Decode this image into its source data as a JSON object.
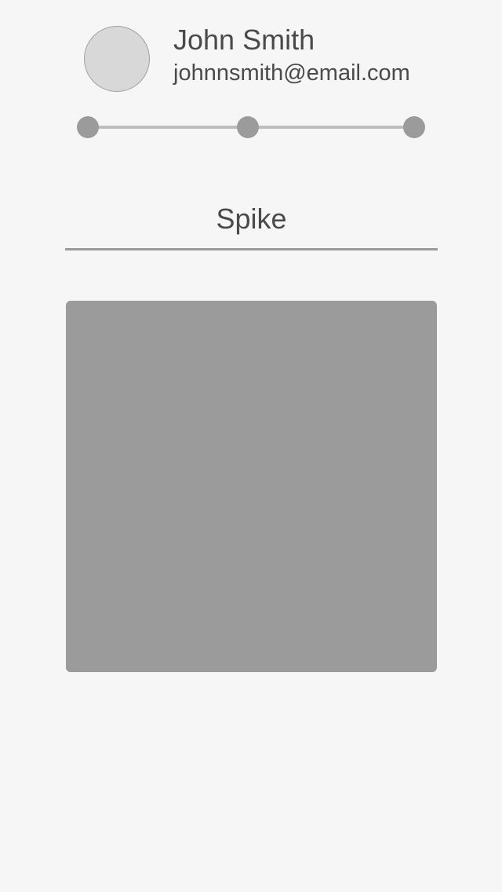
{
  "profile": {
    "name": "John Smith",
    "email": "johnnsmith@email.com"
  },
  "stepper": {
    "steps": 3
  },
  "card": {
    "title": "Spike"
  },
  "colors": {
    "background": "#f6f6f6",
    "text": "#4a4a4a",
    "accent_gray": "#9b9b9b",
    "track_gray": "#bdbdbd",
    "avatar_fill": "#d8d8d8"
  }
}
